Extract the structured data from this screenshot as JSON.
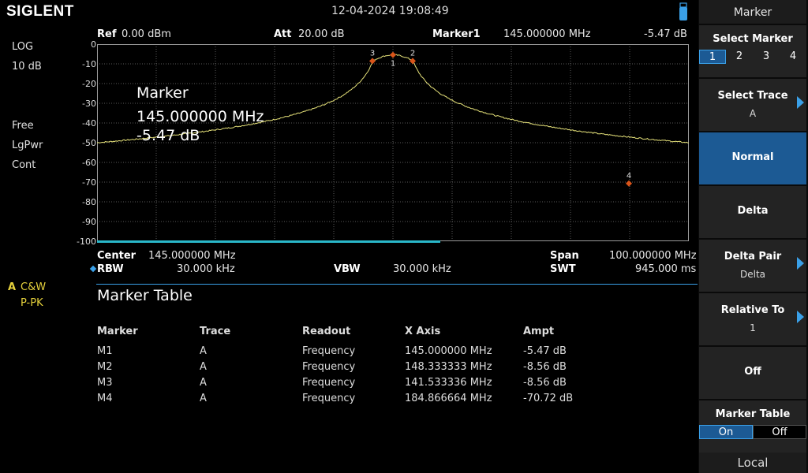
{
  "brand": "SIGLENT",
  "datetime": "12-04-2024  19:08:49",
  "left_panel": {
    "scale_type": "LOG",
    "scale_div": "10 dB",
    "sweep": "Free",
    "detector_avg": "LgPwr",
    "trigger": "Cont",
    "trace_letter": "A",
    "trace_mode": "C&W",
    "trace_detector": "P-PK"
  },
  "header": {
    "ref_label": "Ref",
    "ref_value": "0.00 dBm",
    "att_label": "Att",
    "att_value": "20.00 dB",
    "marker_label": "Marker1",
    "marker_freq": "145.000000 MHz",
    "marker_ampl": "-5.47 dB"
  },
  "y_axis": [
    "0",
    "-10",
    "-20",
    "-30",
    "-40",
    "-50",
    "-60",
    "-70",
    "-80",
    "-90",
    "-100"
  ],
  "overlay": {
    "line1": "Marker",
    "line2": "145.000000 MHz",
    "line3": "-5.47 dB"
  },
  "markers_on_plot": [
    "1",
    "2",
    "3",
    "4"
  ],
  "footer": {
    "center_label": "Center",
    "center_value": "145.000000 MHz",
    "span_label": "Span",
    "span_value": "100.000000 MHz",
    "rbw_label": "RBW",
    "rbw_value": "30.000 kHz",
    "vbw_label": "VBW",
    "vbw_value": "30.000 kHz",
    "swt_label": "SWT",
    "swt_value": "945.000 ms"
  },
  "marker_table": {
    "title": "Marker Table",
    "headers": [
      "Marker",
      "Trace",
      "Readout",
      "X Axis",
      "Ampt"
    ],
    "rows": [
      [
        "M1",
        "A",
        "Frequency",
        "145.000000 MHz",
        "-5.47 dB"
      ],
      [
        "M2",
        "A",
        "Frequency",
        "148.333333 MHz",
        "-8.56 dB"
      ],
      [
        "M3",
        "A",
        "Frequency",
        "141.533336 MHz",
        "-8.56 dB"
      ],
      [
        "M4",
        "A",
        "Frequency",
        "184.866664 MHz",
        "-70.72 dB"
      ]
    ]
  },
  "menu": {
    "title": "Marker",
    "select_marker": "Select Marker",
    "select_marker_options": [
      "1",
      "2",
      "3",
      "4"
    ],
    "select_trace": "Select Trace",
    "select_trace_value": "A",
    "normal": "Normal",
    "delta": "Delta",
    "delta_pair": "Delta Pair",
    "delta_pair_value": "Delta",
    "relative_to": "Relative To",
    "relative_to_value": "1",
    "off": "Off",
    "marker_table": "Marker Table",
    "marker_table_on": "On",
    "marker_table_off": "Off",
    "local": "Local"
  },
  "colors": {
    "trace": "#e6e27a",
    "marker": "#d9541a",
    "accent": "#3aa0e8",
    "selected": "#1c5a94"
  }
}
